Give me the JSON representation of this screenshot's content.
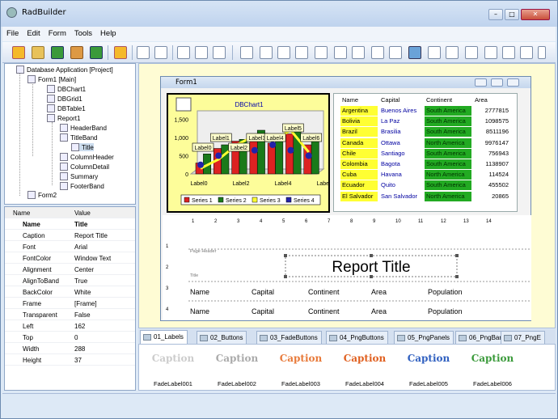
{
  "window": {
    "title": "RadBuilder",
    "min": "–",
    "max": "□",
    "close": "✕"
  },
  "menu": [
    "File",
    "Edit",
    "Form",
    "Tools",
    "Help"
  ],
  "tree": {
    "root": "Database Application [Project]",
    "form1": "Form1 [Main]",
    "dbchart": "DBChart1",
    "dbgrid": "DBGrid1",
    "dbtable": "DBTable1",
    "report": "Report1",
    "headerband": "HeaderBand",
    "titleband": "TitleBand",
    "title": "Title",
    "colheader": "ColumnHeader",
    "coldetail": "ColumnDetail",
    "summary": "Summary",
    "footer": "FooterBand",
    "form2": "Form2"
  },
  "props": {
    "head": {
      "name": "Name",
      "value": "Value"
    },
    "rows": [
      {
        "n": "Name",
        "v": "Title"
      },
      {
        "n": "Caption",
        "v": "Report Title"
      },
      {
        "n": "Font",
        "v": "Arial"
      },
      {
        "n": "FontColor",
        "v": "Window Text"
      },
      {
        "n": "Alignment",
        "v": "Center"
      },
      {
        "n": "AlignToBand",
        "v": "True"
      },
      {
        "n": "BackColor",
        "v": "White"
      },
      {
        "n": "Frame",
        "v": "[Frame]"
      },
      {
        "n": "Transparent",
        "v": "False"
      },
      {
        "n": "Left",
        "v": "162"
      },
      {
        "n": "Top",
        "v": "0"
      },
      {
        "n": "Width",
        "v": "288"
      },
      {
        "n": "Height",
        "v": "37"
      }
    ]
  },
  "form": {
    "title": "Form1",
    "min": "–",
    "max": "□",
    "close": "✕"
  },
  "chart_data": {
    "type": "bar",
    "title": "DBChart1",
    "categories": [
      "Label0",
      "Label1",
      "Label2",
      "Label3",
      "Label4",
      "Label5",
      "Label6"
    ],
    "x_ticks": [
      "Label0",
      "Label2",
      "Label4",
      "Label6"
    ],
    "y_ticks": [
      "0",
      "500",
      "1,000",
      "1,500"
    ],
    "ylim": [
      0,
      1600
    ],
    "series": [
      {
        "name": "Series 1",
        "color": "#d22",
        "values": [
          300,
          700,
          900,
          1000,
          850,
          1100,
          800
        ]
      },
      {
        "name": "Series 2",
        "color": "#1a7a1a",
        "values": [
          550,
          800,
          950,
          1200,
          1000,
          1300,
          950
        ]
      },
      {
        "name": "Series 3",
        "color": "#ff3",
        "values": [
          150,
          400,
          800,
          1050,
          900,
          1200,
          600
        ]
      },
      {
        "name": "Series 4",
        "color": "#22a",
        "values": [
          250,
          500,
          700,
          650,
          800,
          650,
          500
        ]
      }
    ],
    "legend": "bottom"
  },
  "grid": {
    "headers": [
      "Name",
      "Capital",
      "Continent",
      "Area"
    ],
    "rows": [
      [
        "Argentina",
        "Buenos Aires",
        "South America",
        "2777815"
      ],
      [
        "Bolivia",
        "La Paz",
        "South America",
        "1098575"
      ],
      [
        "Brazil",
        "Brasilia",
        "South America",
        "8511196"
      ],
      [
        "Canada",
        "Ottawa",
        "North America",
        "9976147"
      ],
      [
        "Chile",
        "Santiago",
        "South America",
        "756943"
      ],
      [
        "Colombia",
        "Bagota",
        "South America",
        "1138907"
      ],
      [
        "Cuba",
        "Havana",
        "North America",
        "114524"
      ],
      [
        "Ecuador",
        "Quito",
        "South America",
        "455502"
      ],
      [
        "El Salvador",
        "San Salvador",
        "North America",
        "20865"
      ]
    ]
  },
  "report": {
    "page_header": "Page Header",
    "title_band": "Title",
    "title": "Report Title",
    "columns": [
      "Name",
      "Capital",
      "Continent",
      "Area",
      "Population"
    ],
    "ruler": [
      "1",
      "2",
      "3",
      "4",
      "5",
      "6",
      "7",
      "8",
      "9",
      "10",
      "11",
      "12",
      "13",
      "14"
    ],
    "rows": [
      "1",
      "2",
      "3",
      "4"
    ]
  },
  "tabs": [
    "01_Labels",
    "02_Buttons",
    "03_FadeButtons",
    "04_PngButtons",
    "05_PngPanels",
    "06_PngBars",
    "07_PngE"
  ],
  "palette": [
    {
      "caption": "Caption",
      "label": "FadeLabel001",
      "color": "#ccc"
    },
    {
      "caption": "Caption",
      "label": "FadeLabel002",
      "color": "#aaa"
    },
    {
      "caption": "Caption",
      "label": "FadeLabel003",
      "color": "#e87a3a"
    },
    {
      "caption": "Caption",
      "label": "FadeLabel004",
      "color": "#e06020"
    },
    {
      "caption": "Caption",
      "label": "FadeLabel005",
      "color": "#3060c0"
    },
    {
      "caption": "Caption",
      "label": "FadeLabel006",
      "color": "#3a9a3a"
    }
  ]
}
